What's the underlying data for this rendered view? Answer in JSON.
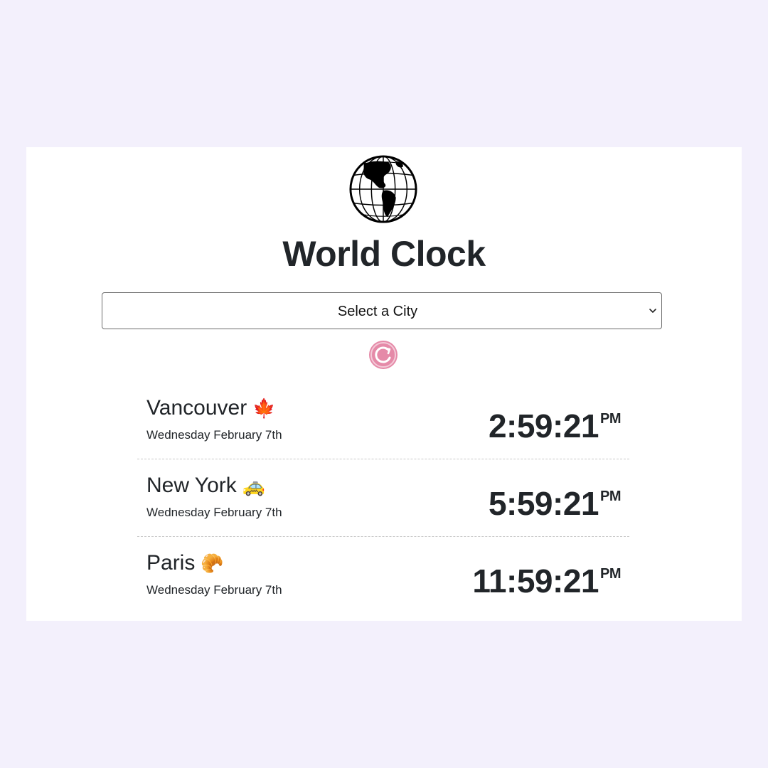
{
  "app": {
    "title": "World Clock",
    "globe_icon": "globe-americas-icon"
  },
  "select": {
    "selected_value": "Select a City",
    "icon": "chevron-down-icon"
  },
  "reset": {
    "icon": "refresh-icon",
    "color": "#e58aa8"
  },
  "cities": [
    {
      "name": "Vancouver",
      "emoji": "🍁",
      "date": "Wednesday February 7th",
      "time": "2:59:21",
      "ampm": "PM"
    },
    {
      "name": "New York",
      "emoji": "🚕",
      "date": "Wednesday February 7th",
      "time": "5:59:21",
      "ampm": "PM"
    },
    {
      "name": "Paris",
      "emoji": "🥐",
      "date": "Wednesday February 7th",
      "time": "11:59:21",
      "ampm": "PM"
    }
  ],
  "colors": {
    "page_background": "#f3f0fc",
    "card_background": "#ffffff",
    "text": "#212529",
    "accent": "#e58aa8"
  }
}
